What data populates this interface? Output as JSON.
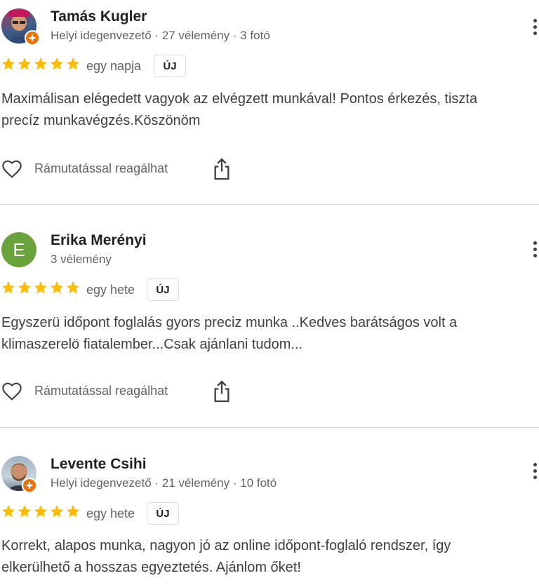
{
  "reviews": [
    {
      "name": "Tamás Kugler",
      "meta": "Helyi idegenvezető · 27 vélemény · 3 fotó",
      "avatar_type": "photo",
      "avatar_letter": "",
      "local_guide": true,
      "rating": 5,
      "date": "egy napja",
      "badge": "ÚJ",
      "text_lines": [
        "Maximálisan elégedett vagyok az elvégzett munkával! Pontos érkezés, tiszta",
        "precíz munkavégzés.Köszönöm"
      ],
      "react_label": "Rámutatással reagálhat"
    },
    {
      "name": "Erika Merényi",
      "meta": "3 vélemény",
      "avatar_type": "letter",
      "avatar_letter": "E",
      "local_guide": false,
      "rating": 5,
      "date": "egy hete",
      "badge": "ÚJ",
      "text_lines": [
        "Egyszerü időpont foglalás gyors preciz munka ..Kedves barátságos volt a",
        "klimaszerelö fiatalember...Csak ajánlani tudom..."
      ],
      "react_label": "Rámutatással reagálhat"
    },
    {
      "name": "Levente Csihi",
      "meta": "Helyi idegenvezető · 21 vélemény · 10 fotó",
      "avatar_type": "photo",
      "avatar_letter": "",
      "local_guide": true,
      "rating": 5,
      "date": "egy hete",
      "badge": "ÚJ",
      "text_lines": [
        "Korrekt, alapos munka, nagyon jó az online időpont-foglaló rendszer, így",
        "elkerülhető a hosszas egyeztetés. Ajánlom őket!"
      ],
      "react_label": ""
    }
  ],
  "colors": {
    "star": "#fbbc04",
    "avatar_letter_bg": "#6aa33c",
    "guide_badge": "#e8710a",
    "divider": "#dadce0"
  },
  "icons": [
    "more-vert-icon",
    "star-icon",
    "local-guide-icon",
    "heart-icon",
    "share-icon"
  ]
}
